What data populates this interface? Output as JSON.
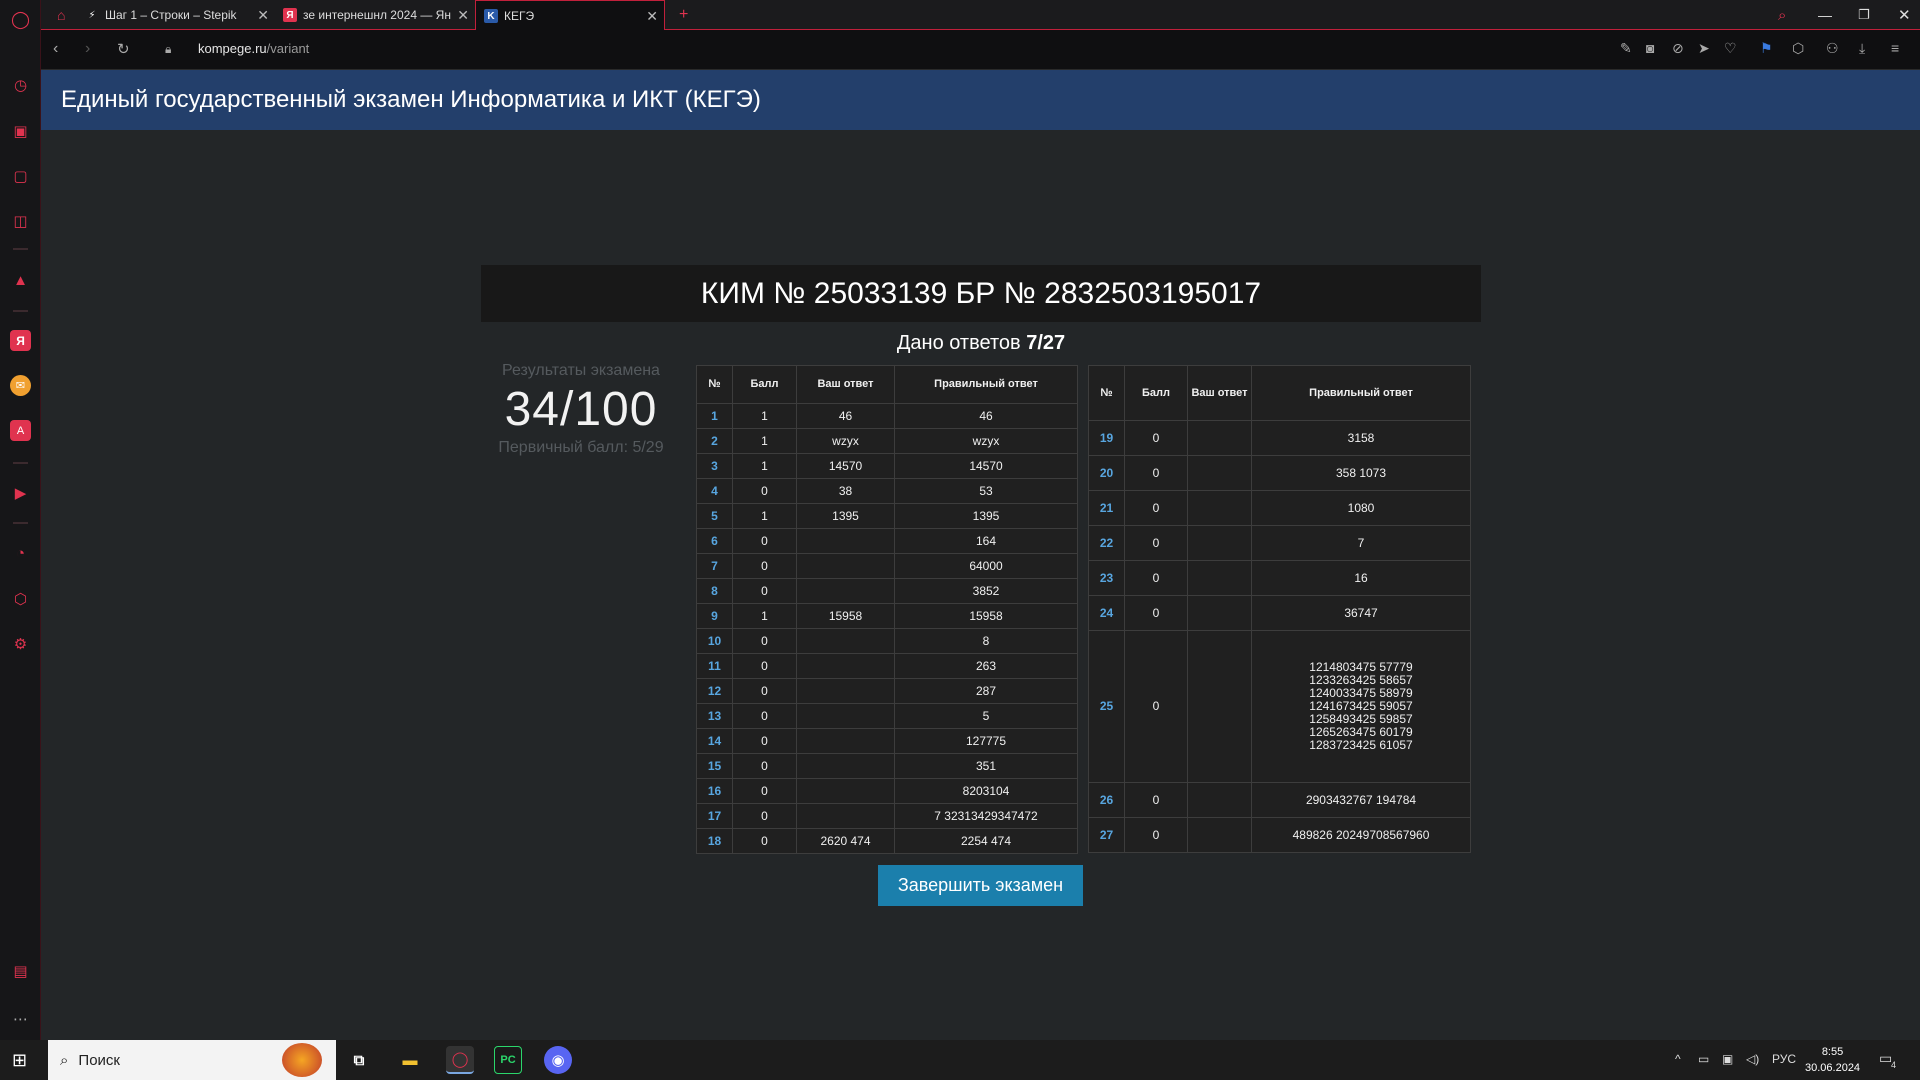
{
  "browser": {
    "tabs": [
      {
        "title": "Шаг 1 – Строки – Stepik",
        "favicon": "stepik-icon",
        "fav_glyph": "⚡",
        "close": "✕"
      },
      {
        "title": "зе интернешнл 2024 — Ян",
        "favicon": "yandex-icon",
        "fav_glyph": "Я",
        "close": "✕"
      },
      {
        "title": "КЕГЭ",
        "favicon": "kege-icon",
        "fav_glyph": "K",
        "close": "✕"
      }
    ],
    "new_tab": "+",
    "url_domain": "kompege.ru",
    "url_path": "/variant"
  },
  "page": {
    "header_title": "Единый государственный экзамен Информатика и ИКТ (КЕГЭ)",
    "kim_title": "КИМ № 25033139 БР № 2832503195017",
    "answered_label": "Дано ответов",
    "answered_value": "7/27",
    "results_label": "Результаты экзамена",
    "score": "34/100",
    "primary_score": "Первичный балл: 5/29",
    "table_headers": {
      "num": "№",
      "score": "Балл",
      "your_answer": "Ваш ответ",
      "correct_answer": "Правильный ответ"
    },
    "table1_rows": [
      {
        "n": "1",
        "s": "1",
        "a": "46",
        "c": "46"
      },
      {
        "n": "2",
        "s": "1",
        "a": "wzyx",
        "c": "wzyx"
      },
      {
        "n": "3",
        "s": "1",
        "a": "14570",
        "c": "14570"
      },
      {
        "n": "4",
        "s": "0",
        "a": "38",
        "c": "53"
      },
      {
        "n": "5",
        "s": "1",
        "a": "1395",
        "c": "1395"
      },
      {
        "n": "6",
        "s": "0",
        "a": "",
        "c": "164"
      },
      {
        "n": "7",
        "s": "0",
        "a": "",
        "c": "64000"
      },
      {
        "n": "8",
        "s": "0",
        "a": "",
        "c": "3852"
      },
      {
        "n": "9",
        "s": "1",
        "a": "15958",
        "c": "15958"
      },
      {
        "n": "10",
        "s": "0",
        "a": "",
        "c": "8"
      },
      {
        "n": "11",
        "s": "0",
        "a": "",
        "c": "263"
      },
      {
        "n": "12",
        "s": "0",
        "a": "",
        "c": "287"
      },
      {
        "n": "13",
        "s": "0",
        "a": "",
        "c": "5"
      },
      {
        "n": "14",
        "s": "0",
        "a": "",
        "c": "127775"
      },
      {
        "n": "15",
        "s": "0",
        "a": "",
        "c": "351"
      },
      {
        "n": "16",
        "s": "0",
        "a": "",
        "c": "8203104"
      },
      {
        "n": "17",
        "s": "0",
        "a": "",
        "c": "7 32313429347472"
      },
      {
        "n": "18",
        "s": "0",
        "a": "2620 474",
        "c": "2254 474"
      }
    ],
    "table2_rows": [
      {
        "n": "19",
        "s": "0",
        "a": "",
        "c": "3158"
      },
      {
        "n": "20",
        "s": "0",
        "a": "",
        "c": "358 1073"
      },
      {
        "n": "21",
        "s": "0",
        "a": "",
        "c": "1080"
      },
      {
        "n": "22",
        "s": "0",
        "a": "",
        "c": "7"
      },
      {
        "n": "23",
        "s": "0",
        "a": "",
        "c": "16"
      },
      {
        "n": "24",
        "s": "0",
        "a": "",
        "c": "36747"
      },
      {
        "n": "25",
        "s": "0",
        "a": "",
        "c": "1214803475 57779\n1233263425 58657\n1240033475 58979\n1241673425 59057\n1258493425 59857\n1265263475 60179\n1283723425 61057"
      },
      {
        "n": "26",
        "s": "0",
        "a": "",
        "c": "2903432767 194784"
      },
      {
        "n": "27",
        "s": "0",
        "a": "",
        "c": "489826 20249708567960"
      }
    ],
    "finish_button": "Завершить экзамен"
  },
  "taskbar": {
    "search_placeholder": "Поиск",
    "lang": "РУС",
    "time": "8:55",
    "date": "30.06.2024",
    "notifications": "4"
  },
  "colors": {
    "header": "#233f6b",
    "accent": "#1b7fac",
    "opera_red": "#c1203b",
    "link": "#58a6e0"
  }
}
